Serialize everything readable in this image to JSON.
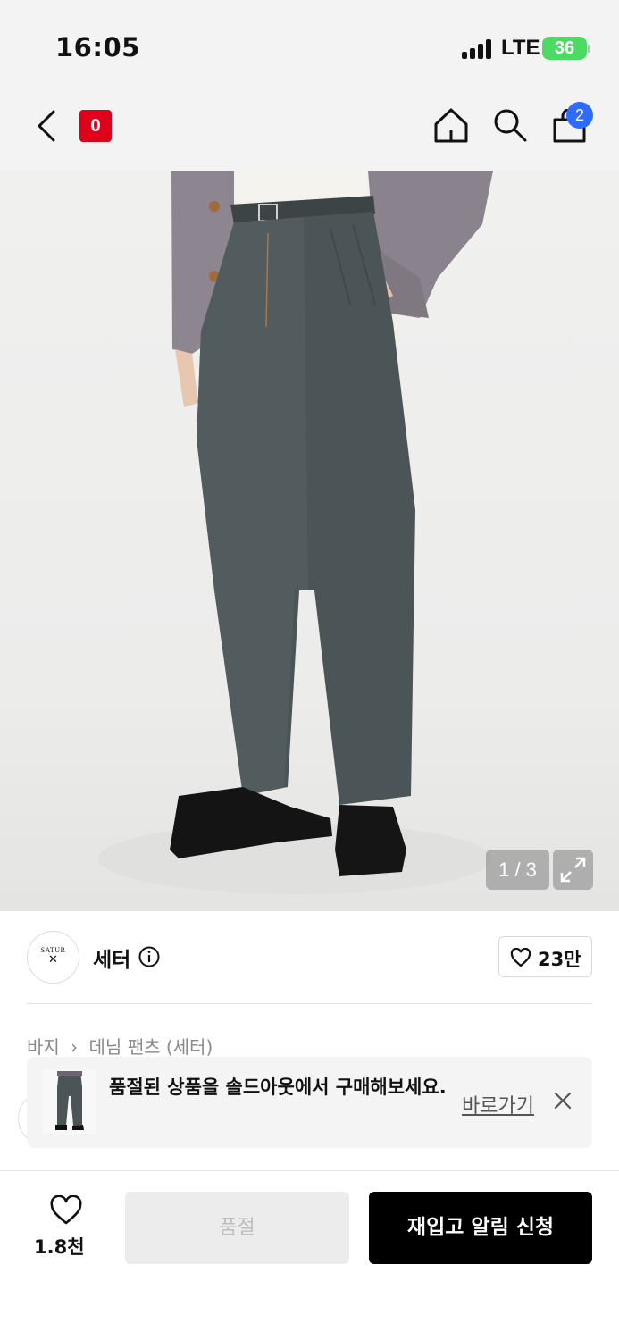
{
  "status_bar": {
    "time": "16:05",
    "network": "LTE",
    "battery": "36"
  },
  "nav": {
    "logo_text": "0",
    "cart_count": "2"
  },
  "gallery": {
    "counter": "1 / 3"
  },
  "brand": {
    "logo_line1": "SATUR",
    "logo_line2": "✕",
    "name": "세터",
    "likes": "23만"
  },
  "breadcrumb": [
    "바지",
    "›",
    "데님 팬츠 (세터)"
  ],
  "soldout_banner": {
    "text": "품절된 상품을 솔드아웃에서 구매해보세요.",
    "link": "바로가기"
  },
  "bottom_bar": {
    "wish_count": "1.8천",
    "soldout_label": "품절",
    "restock_label": "재입고 알림 신청"
  },
  "colors": {
    "brand_red": "#e0001a",
    "cart_badge_blue": "#2f6bff",
    "battery_green": "#4cd964"
  }
}
